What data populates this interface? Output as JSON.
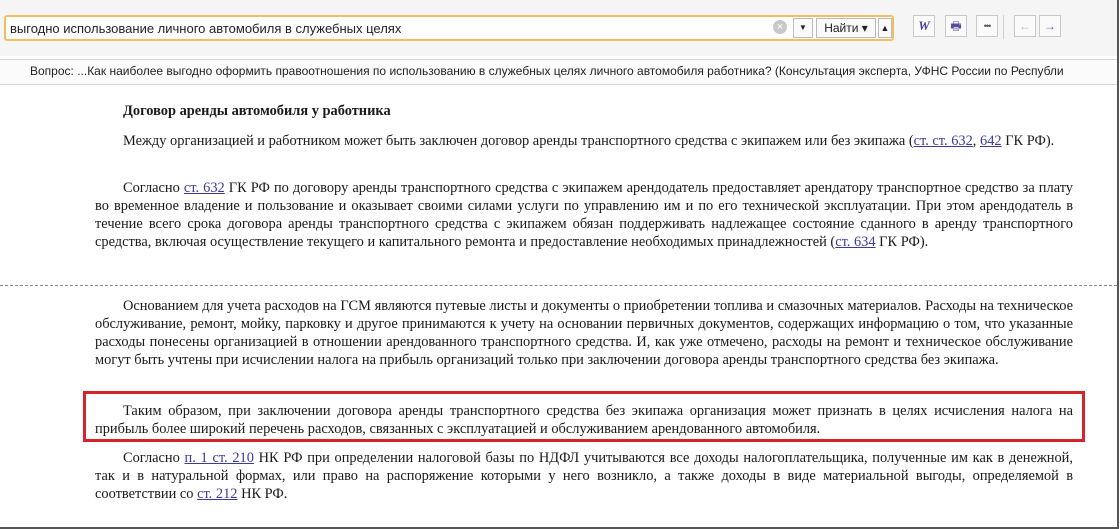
{
  "search": {
    "query": "выгодно использование личного автомобиля в служебных целях",
    "find_label": "Найти",
    "clear_glyph": "×",
    "dropdown_glyph": "▼",
    "find_arrow_glyph": "▾",
    "up_glyph": "▲"
  },
  "toolbar": {
    "word_label": "W",
    "print_glyph": "🖶",
    "more_glyph": "•••",
    "back_glyph": "←",
    "forward_glyph": "→"
  },
  "breadcrumb": {
    "text": "Вопрос: ...Как наиболее выгодно оформить правоотношения по использованию в служебных целях личного автомобиля работника? (Консультация эксперта, УФНС России по Республи"
  },
  "document": {
    "heading": "Договор аренды автомобиля у работника",
    "p1": {
      "text_a": "Между организацией и работником может быть заключен договор аренды транспортного средства с экипажем или без экипажа (",
      "link1": "ст. ст. 632",
      "sep": ", ",
      "link2": "642",
      "text_b": " ГК РФ)."
    },
    "p2": {
      "text_a": "Согласно ",
      "link1": "ст. 632",
      "text_b": " ГК РФ по договору аренды транспортного средства с экипажем арендодатель предоставляет арендатору транспортное средство за плату во временное владение и пользование и оказывает своими силами услуги по управлению им и по его технической эксплуатации. При этом арендодатель в течение всего срока договора аренды транспортного средства с экипажем обязан поддерживать надлежащее состояние сданного в аренду транспортного средства, включая осуществление текущего и капитального ремонта и предоставление необходимых принадлежностей (",
      "link2": "ст. 634",
      "text_c": " ГК РФ)."
    },
    "p3": {
      "text": "Основанием для учета расходов на ГСМ являются путевые листы и документы о приобретении топлива и смазочных материалов. Расходы на техническое обслуживание, ремонт, мойку, парковку и другое принимаются к учету на основании первичных документов, содержащих информацию о том, что указанные расходы понесены организацией в отношении арендованного транспортного средства. И, как уже отмечено, расходы на ремонт и техническое обслуживание могут быть учтены при исчислении налога на прибыль организаций только при заключении договора аренды транспортного средства без экипажа."
    },
    "p4": {
      "text": "Таким образом, при заключении договора аренды транспортного средства без экипажа организация может признать в целях исчисления налога на прибыль более широкий перечень расходов, связанных с эксплуатацией и обслуживанием арендованного автомобиля."
    },
    "p5": {
      "text_a": "Согласно ",
      "link1": "п. 1 ст. 210",
      "text_b": " НК РФ при определении налоговой базы по НДФЛ учитываются все доходы налогоплательщика, полученные им как в денежной, так и в натуральной формах, или право на распоряжение которыми у него возникло, а также доходы в виде материальной выгоды, определяемой в соответствии со ",
      "link2": "ст. 212",
      "text_c": " НК РФ."
    }
  },
  "colors": {
    "highlight_border": "#d9232b",
    "link": "#3b3b9b",
    "search_border": "#f0c060"
  }
}
